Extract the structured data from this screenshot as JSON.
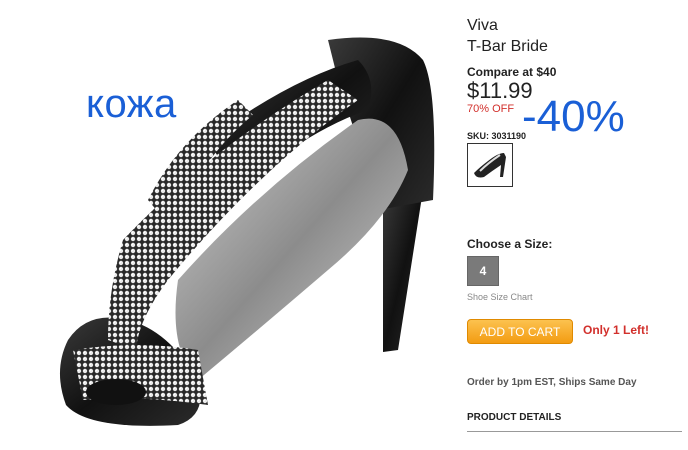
{
  "overlays": {
    "leather_text": "кожа",
    "discount_text": "-40%",
    "color": "#1a5fd6"
  },
  "product": {
    "brand": "Viva",
    "name": "T-Bar Bride",
    "compare_label": "Compare at $40",
    "price": "$11.99",
    "discount": "70% OFF",
    "sku_label": "SKU: 3031190",
    "thumbnail_icon": "shoe-thumbnail"
  },
  "size": {
    "title": "Choose a Size:",
    "selected": "4",
    "chart_link": "Shoe Size Chart"
  },
  "cart": {
    "button_label": "ADD TO CART",
    "stock_text": "Only 1 Left!"
  },
  "shipping": {
    "text": "Order by 1pm EST, Ships Same Day"
  },
  "details": {
    "heading": "PRODUCT DETAILS"
  },
  "colors": {
    "accent_orange": "#f39c12",
    "sale_red": "#d2302c",
    "overlay_blue": "#1a5fd6"
  }
}
